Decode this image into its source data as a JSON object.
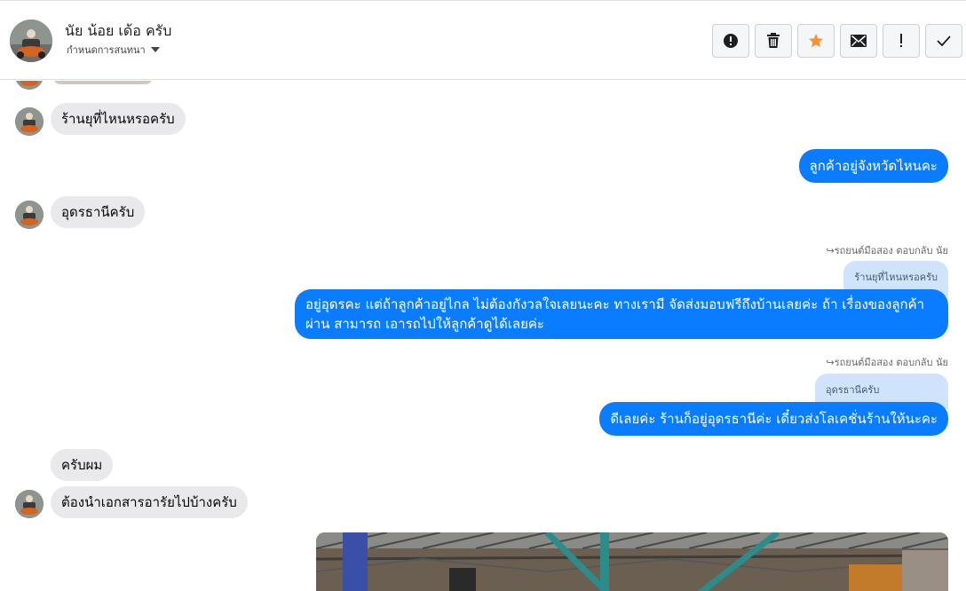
{
  "header": {
    "name": "นัย น้อย เด้อ ครับ",
    "subtitle": "กำหนดการสนทนา",
    "toolbar": [
      {
        "name": "alert-circle-icon"
      },
      {
        "name": "trash-icon"
      },
      {
        "name": "star-icon",
        "color": "#f7923a"
      },
      {
        "name": "envelope-icon"
      },
      {
        "name": "exclamation-icon"
      },
      {
        "name": "check-icon"
      }
    ]
  },
  "messages": {
    "m1": "ร้านยุที่ไหนหรอครับ",
    "m2": "ลูกค้าอยู่จังหวัดไหนคะ",
    "m3": "อุดรธานีครับ",
    "reply1_label": "รถยนต์มือสอง ตอบกลับ นัย",
    "reply1_quote": "ร้านยุที่ไหนหรอครับ",
    "m4_line1": "อยู่อุดรคะ แต่ถ้าลูกค้าอยู่ไกล ไม่ต้องกังวลใจเลยนะคะ ทางเรามี จัดส่งมอบฟรีถึงบ้านเลยค่ะ ถ้า เรื่องของลูกค้า",
    "m4_line2": "ผ่าน สามารถ เอารถไปให้ลูกค้าดูได้เลยค่ะ",
    "reply2_label": "รถยนต์มือสอง ตอบกลับ นัย",
    "reply2_quote": "อุดรธานีครับ",
    "m5": "ดีเลยค่ะ ร้านก็อยู่อุดรธานีค่ะ เดี๋ยวส่งโลเคชั่นร้านให้นะคะ",
    "m6": "ครับผม",
    "m7": "ต้องนำเอกสารอารัยไปบ้างครับ"
  },
  "colors": {
    "outgoing": "#0a7cff",
    "incoming": "#e9e9eb",
    "quote": "#cfe3fd"
  }
}
